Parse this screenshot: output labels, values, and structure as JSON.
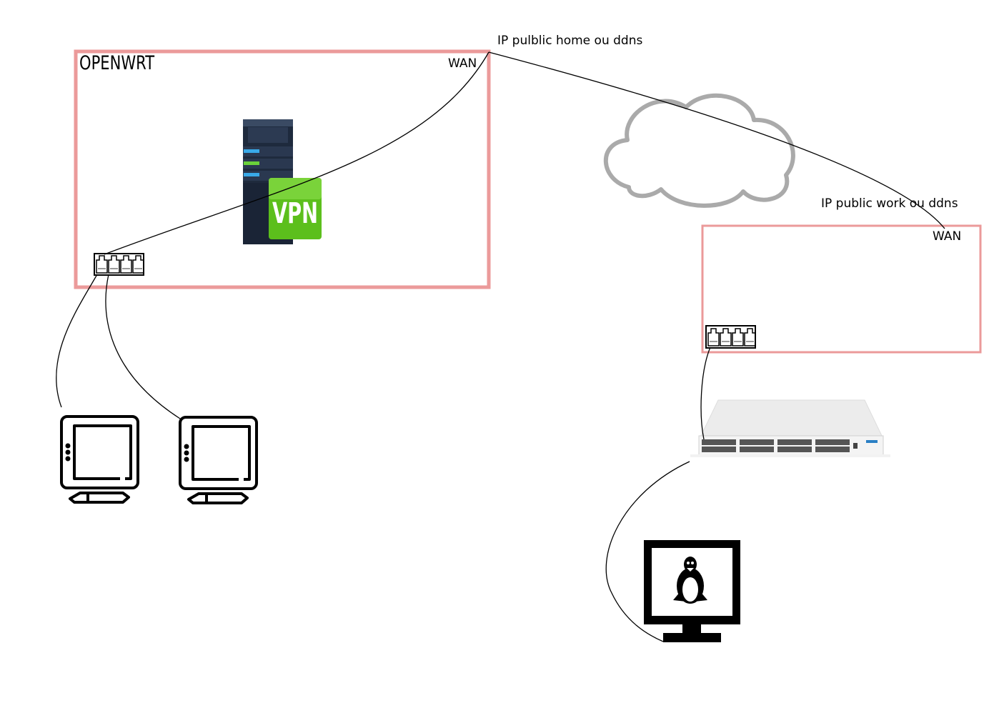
{
  "router_home": {
    "title": "OPENWRT",
    "wan_label": "WAN"
  },
  "router_work": {
    "wan_label": "WAN"
  },
  "labels": {
    "ip_home": "IP pulblic home ou ddns",
    "ip_work": "IP public work ou ddns"
  },
  "vpn_server": {
    "badge": "VPN"
  },
  "colors": {
    "router_border": "#eb9a9a",
    "cloud_stroke": "#aaaaaa",
    "vpn_green": "#5cbf1c"
  }
}
